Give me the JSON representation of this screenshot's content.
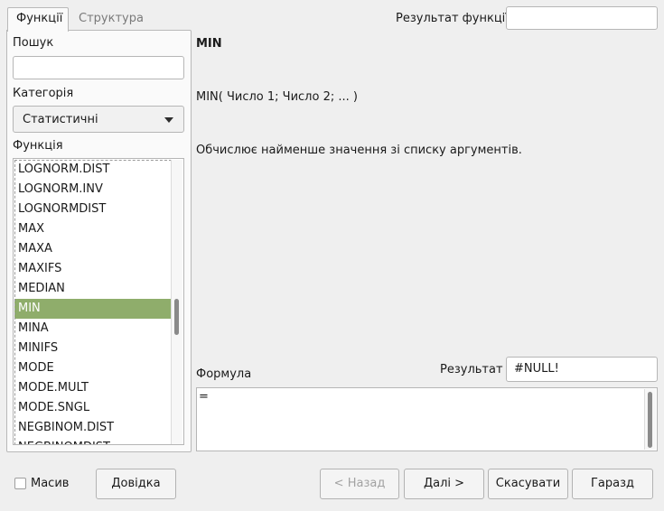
{
  "tabs": {
    "functions": "Функції",
    "structure": "Структура"
  },
  "search": {
    "label": "Пошук",
    "value": ""
  },
  "category": {
    "label": "Категорія",
    "selected": "Статистичні"
  },
  "function_list": {
    "label": "Функція",
    "items": [
      "LOGNORM.DIST",
      "LOGNORM.INV",
      "LOGNORMDIST",
      "MAX",
      "MAXA",
      "MAXIFS",
      "MEDIAN",
      "MIN",
      "MINA",
      "MINIFS",
      "MODE",
      "MODE.MULT",
      "MODE.SNGL",
      "NEGBINOM.DIST",
      "NEGBINOMDIST"
    ],
    "selected_index": 7
  },
  "function_result": {
    "label": "Результат функції",
    "value": ""
  },
  "details": {
    "name": "MIN",
    "syntax": "MIN( Число 1; Число 2; ... )",
    "description": "Обчислює найменше значення зі списку аргументів."
  },
  "formula": {
    "label": "Формула",
    "value": "="
  },
  "result": {
    "label": "Результат",
    "value": "#NULL!"
  },
  "array_checkbox": {
    "label": "Масив",
    "checked": false
  },
  "buttons": {
    "help": "Довідка",
    "back": "< Назад",
    "next": "Далі >",
    "cancel": "Скасувати",
    "ok": "Гаразд"
  },
  "colors": {
    "selection": "#8fad6b",
    "background": "#efefef"
  }
}
